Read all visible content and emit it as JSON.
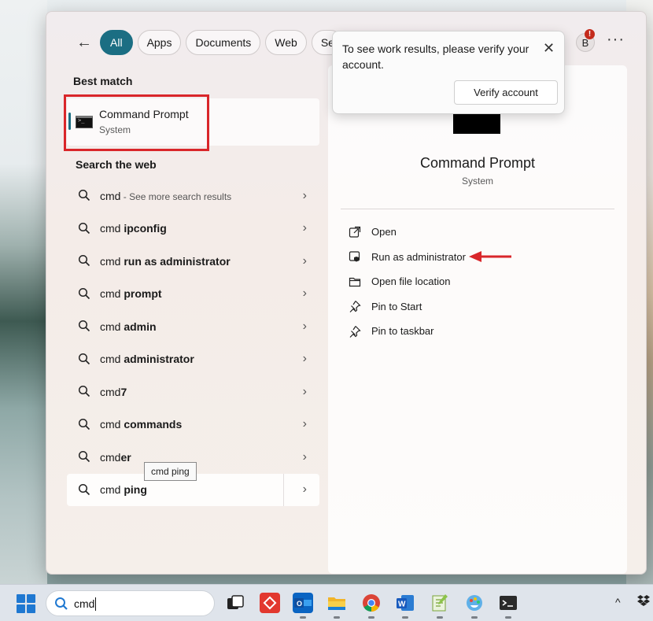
{
  "filters": {
    "back": "←",
    "chips": [
      "All",
      "Apps",
      "Documents",
      "Web",
      "Setti"
    ],
    "avatar_letter": "B",
    "avatar_badge": "!",
    "more": "···"
  },
  "best_match": {
    "heading": "Best match",
    "title": "Command Prompt",
    "subtitle": "System"
  },
  "web": {
    "heading": "Search the web",
    "items": [
      {
        "prefix": "cmd",
        "bold": "",
        "hint": " - See more search results"
      },
      {
        "prefix": "cmd ",
        "bold": "ipconfig",
        "hint": ""
      },
      {
        "prefix": "cmd ",
        "bold": "run as administrator",
        "hint": ""
      },
      {
        "prefix": "cmd ",
        "bold": "prompt",
        "hint": ""
      },
      {
        "prefix": "cmd ",
        "bold": "admin",
        "hint": ""
      },
      {
        "prefix": "cmd ",
        "bold": "administrator",
        "hint": ""
      },
      {
        "prefix": "cmd",
        "bold": "7",
        "hint": ""
      },
      {
        "prefix": "cmd ",
        "bold": "commands",
        "hint": ""
      },
      {
        "prefix": "cmd",
        "bold": "er",
        "hint": ""
      },
      {
        "prefix": "cmd ",
        "bold": "ping",
        "hint": ""
      }
    ],
    "tooltip": "cmd ping"
  },
  "preview": {
    "title": "Command Prompt",
    "subtitle": "System",
    "actions": [
      "Open",
      "Run as administrator",
      "Open file location",
      "Pin to Start",
      "Pin to taskbar"
    ]
  },
  "popup": {
    "text": "To see work results, please verify your account.",
    "button": "Verify account",
    "close": "✕"
  },
  "taskbar": {
    "search_value": "cmd",
    "tray_chevron": "^"
  },
  "colors": {
    "accent": "#1b6e83",
    "highlight_box": "#d9262a"
  }
}
